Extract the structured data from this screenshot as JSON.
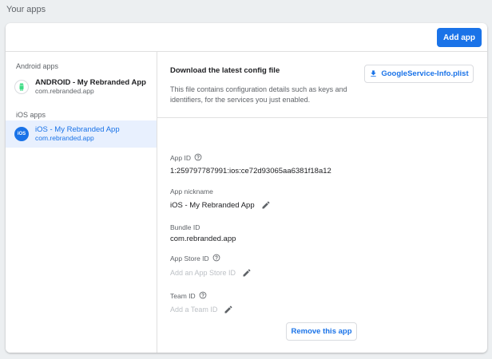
{
  "page": {
    "section_title": "Your apps"
  },
  "header": {
    "add_app_label": "Add app"
  },
  "sidebar": {
    "android_group_label": "Android apps",
    "android_app": {
      "name": "ANDROID - My Rebranded App",
      "package": "com.rebranded.app"
    },
    "ios_group_label": "iOS apps",
    "ios_app": {
      "avatar_text": "iOS",
      "name": "iOS - My Rebranded App",
      "package": "com.rebranded.app"
    }
  },
  "config": {
    "title": "Download the latest config file",
    "description": "This file contains configuration details such as keys and identifiers, for the services you just enabled.",
    "download_label": "GoogleService-Info.plist"
  },
  "fields": {
    "app_id": {
      "label": "App ID",
      "value": "1:259797787991:ios:ce72d93065aa6381f18a12"
    },
    "nickname": {
      "label": "App nickname",
      "value": "iOS - My Rebranded App"
    },
    "bundle_id": {
      "label": "Bundle ID",
      "value": "com.rebranded.app"
    },
    "app_store_id": {
      "label": "App Store ID",
      "placeholder": "Add an App Store ID"
    },
    "team_id": {
      "label": "Team ID",
      "placeholder": "Add a Team ID"
    }
  },
  "actions": {
    "remove_label": "Remove this app"
  },
  "colors": {
    "accent": "#1a73e8",
    "selected_bg": "#e8f0fe",
    "page_bg": "#eceff1"
  }
}
